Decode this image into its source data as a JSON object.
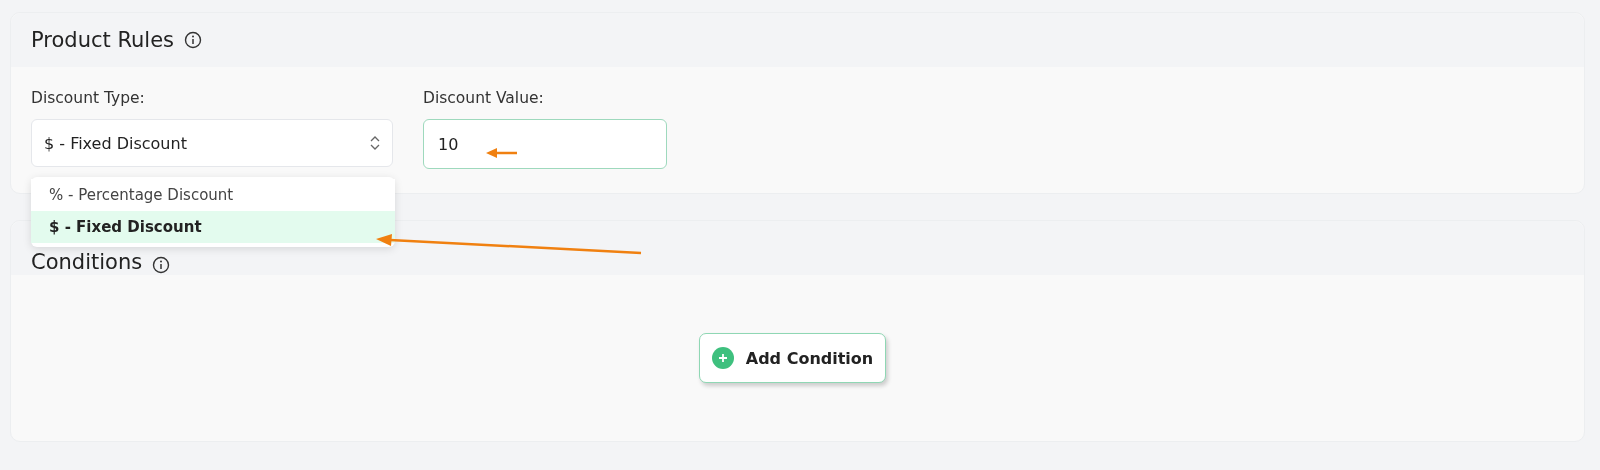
{
  "product_rules": {
    "title": "Product Rules",
    "discount_type": {
      "label": "Discount Type:",
      "value": "$ - Fixed Discount",
      "expanded": true,
      "options": [
        {
          "label": "% - Percentage Discount",
          "selected": false
        },
        {
          "label": "$ - Fixed Discount",
          "selected": true
        }
      ]
    },
    "discount_value": {
      "label": "Discount Value:",
      "value": "10"
    }
  },
  "conditions": {
    "title": "Conditions",
    "add_button": "Add Condition"
  }
}
